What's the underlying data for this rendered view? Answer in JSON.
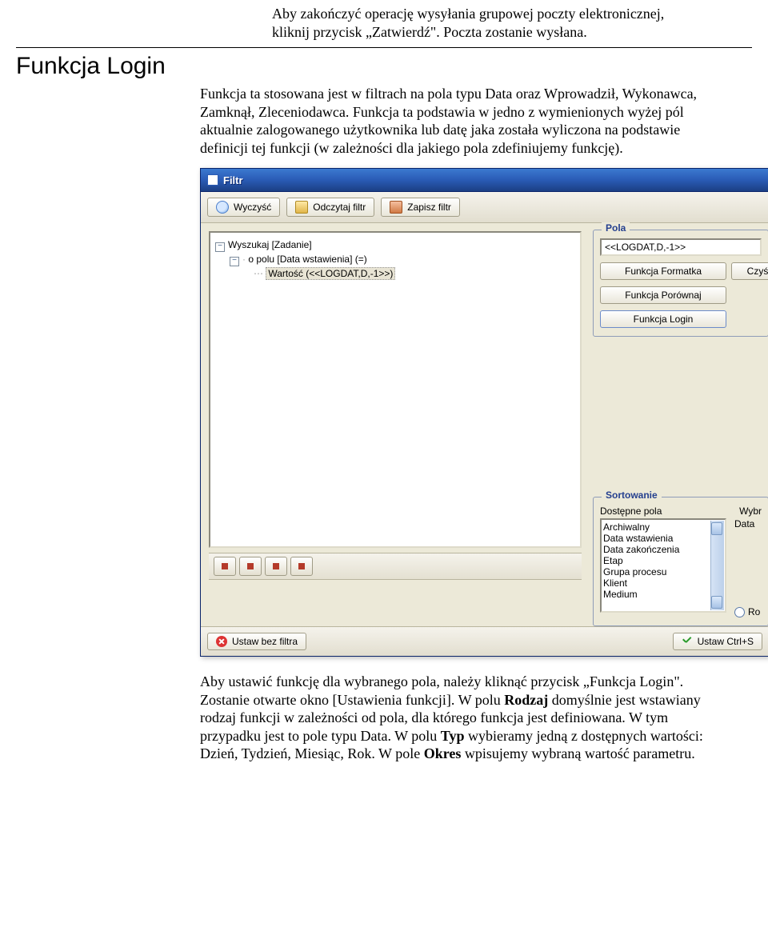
{
  "intro": {
    "para1": "Aby zakończyć operację wysyłania grupowej poczty elektronicznej, kliknij przycisk „Zatwierdź\".  Poczta zostanie wysłana."
  },
  "heading": "Funkcja Login",
  "mid": {
    "para1": "Funkcja ta stosowana jest w filtrach na pola typu Data oraz Wprowadził, Wykonawca, Zamknął, Zleceniodawca. Funkcja ta podstawia w jedno z wymienionych  wyżej pól aktualnie zalogowanego użytkownika lub datę jaka została wyliczona na podstawie definicji tej funkcji (w zależności dla jakiego pola zdefiniujemy funkcję)."
  },
  "win": {
    "title": "Filtr",
    "toolbar": {
      "clear": "Wyczyść",
      "open": "Odczytaj filtr",
      "save": "Zapisz filtr"
    },
    "tree": {
      "root": "Wyszukaj [Zadanie]",
      "node1": "o polu [Data wstawienia] (=)",
      "leaf1": "Wartość (<<LOGDAT,D,-1>>)"
    },
    "pola": {
      "title": "Pola",
      "value": "<<LOGDAT,D,-1>>",
      "btn_format": "Funkcja Formatka",
      "btn_czys": "Czyś",
      "btn_compare": "Funkcja Porównaj",
      "btn_login": "Funkcja Login"
    },
    "sort": {
      "title": "Sortowanie",
      "left_label": "Dostępne pola",
      "right_label": "Wybr",
      "items": [
        "Archiwalny",
        "Data wstawienia",
        "Data zakończenia",
        "Etap",
        "Grupa procesu",
        "Klient",
        "Medium"
      ],
      "right_items": [
        "Data"
      ],
      "radio": "Ro"
    },
    "bottom": {
      "cancel": "Ustaw bez filtra",
      "ok": "Ustaw Ctrl+S"
    }
  },
  "outro": {
    "p_a": "Aby ustawić funkcję dla wybranego pola, należy kliknąć przycisk „Funkcja Login\". Zostanie otwarte okno [Ustawienia funkcji]. W polu ",
    "p_b": "Rodzaj",
    "p_c": " domyślnie jest wstawiany rodzaj funkcji w zależności od pola, dla którego funkcja jest definiowana. W tym przypadku jest to pole typu Data. W polu ",
    "p_d": "Typ",
    "p_e": " wybieramy jedną z dostępnych wartości: Dzień, Tydzień, Miesiąc, Rok. W pole ",
    "p_f": "Okres",
    "p_g": " wpisujemy wybraną wartość parametru."
  }
}
